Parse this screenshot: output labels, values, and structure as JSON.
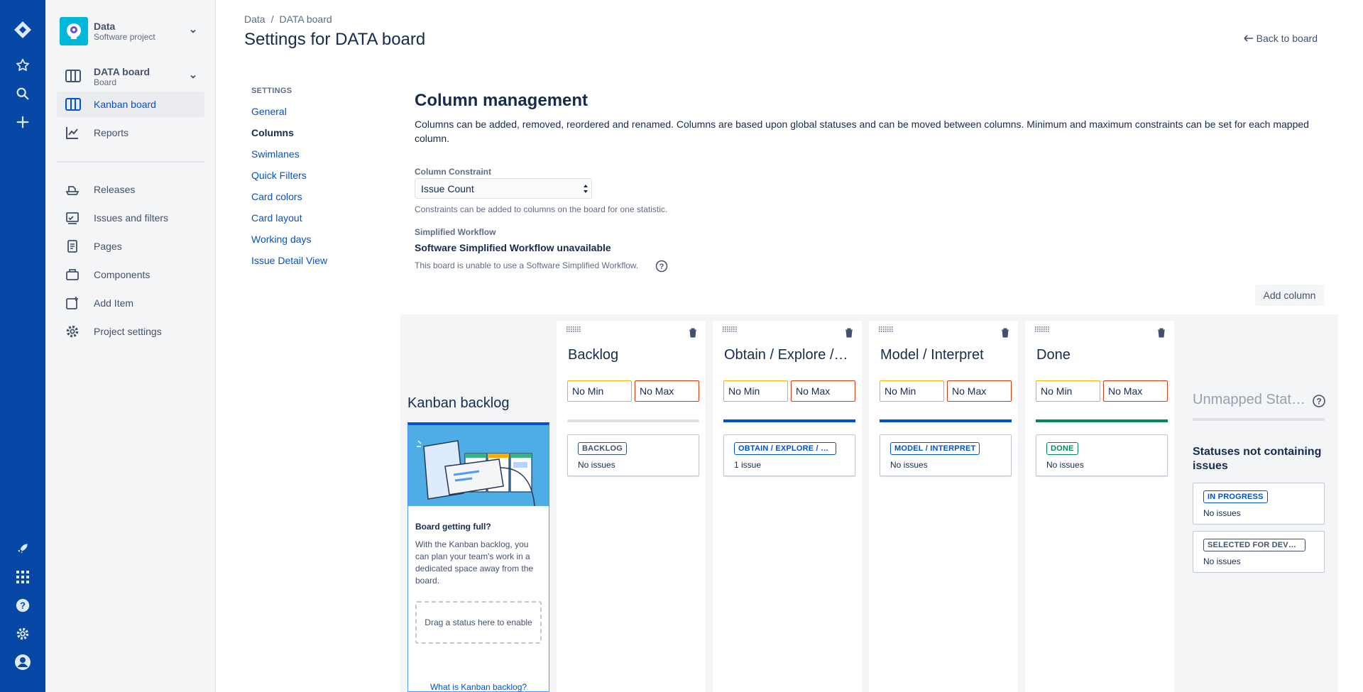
{
  "project": {
    "name": "Data",
    "type": "Software project"
  },
  "board": {
    "name": "DATA board",
    "type": "Board"
  },
  "sidebar": {
    "items": [
      {
        "label": "Kanban board",
        "icon": "board-icon"
      },
      {
        "label": "Reports",
        "icon": "chart-icon"
      },
      {
        "label": "Releases",
        "icon": "ship-icon"
      },
      {
        "label": "Issues and filters",
        "icon": "issues-icon"
      },
      {
        "label": "Pages",
        "icon": "page-icon"
      },
      {
        "label": "Components",
        "icon": "component-icon"
      },
      {
        "label": "Add Item",
        "icon": "add-item-icon"
      },
      {
        "label": "Project settings",
        "icon": "gear-icon"
      }
    ]
  },
  "header": {
    "breadcrumbs": [
      "Data",
      "/",
      "DATA board"
    ],
    "title": "Settings for DATA board",
    "back_link": "Back to board"
  },
  "settings_nav": {
    "heading": "SETTINGS",
    "links": [
      "General",
      "Columns",
      "Swimlanes",
      "Quick Filters",
      "Card colors",
      "Card layout",
      "Working days",
      "Issue Detail View"
    ]
  },
  "column_management": {
    "title": "Column management",
    "description": "Columns can be added, removed, reordered and renamed. Columns are based upon global statuses and can be moved between columns. Minimum and maximum constraints can be set for each mapped column.",
    "constraint_label": "Column Constraint",
    "constraint_value": "Issue Count",
    "constraint_hint": "Constraints can be added to columns on the board for one statistic.",
    "workflow_label": "Simplified Workflow",
    "workflow_status": "Software Simplified Workflow unavailable",
    "workflow_hint": "This board is unable to use a Software Simplified Workflow.",
    "add_column": "Add column"
  },
  "kanban_backlog": {
    "title": "Kanban backlog",
    "heading": "Board getting full?",
    "text": "With the Kanban backlog, you can plan your team's work in a dedicated space away from the board.",
    "drop_hint": "Drag a status here to enable",
    "link": "What is Kanban backlog?"
  },
  "columns": [
    {
      "name": "Backlog",
      "min": "No Min",
      "max": "No Max",
      "status": "BACKLOG",
      "count": "No issues",
      "bar_color": "#dfe1e6",
      "lozenge_color": "#42526e"
    },
    {
      "name": "Obtain / Explore / Scrub",
      "min": "No Min",
      "max": "No Max",
      "status": "OBTAIN / EXPLORE / SCRUB",
      "count": "1 issue",
      "bar_color": "#0052cc",
      "lozenge_color": "#0052cc"
    },
    {
      "name": "Model / Interpret",
      "min": "No Min",
      "max": "No Max",
      "status": "MODEL / INTERPRET",
      "count": "No issues",
      "bar_color": "#0052cc",
      "lozenge_color": "#0052cc"
    },
    {
      "name": "Done",
      "min": "No Min",
      "max": "No Max",
      "status": "DONE",
      "count": "No issues",
      "bar_color": "#00875a",
      "lozenge_color": "#00875a"
    }
  ],
  "unmapped": {
    "title": "Unmapped Statuses",
    "subtitle": "Statuses not containing issues",
    "statuses": [
      {
        "status": "IN PROGRESS",
        "count": "No issues",
        "color": "#0052cc"
      },
      {
        "status": "SELECTED FOR DEVELOPMENT",
        "count": "No issues",
        "color": "#42526e"
      }
    ]
  }
}
